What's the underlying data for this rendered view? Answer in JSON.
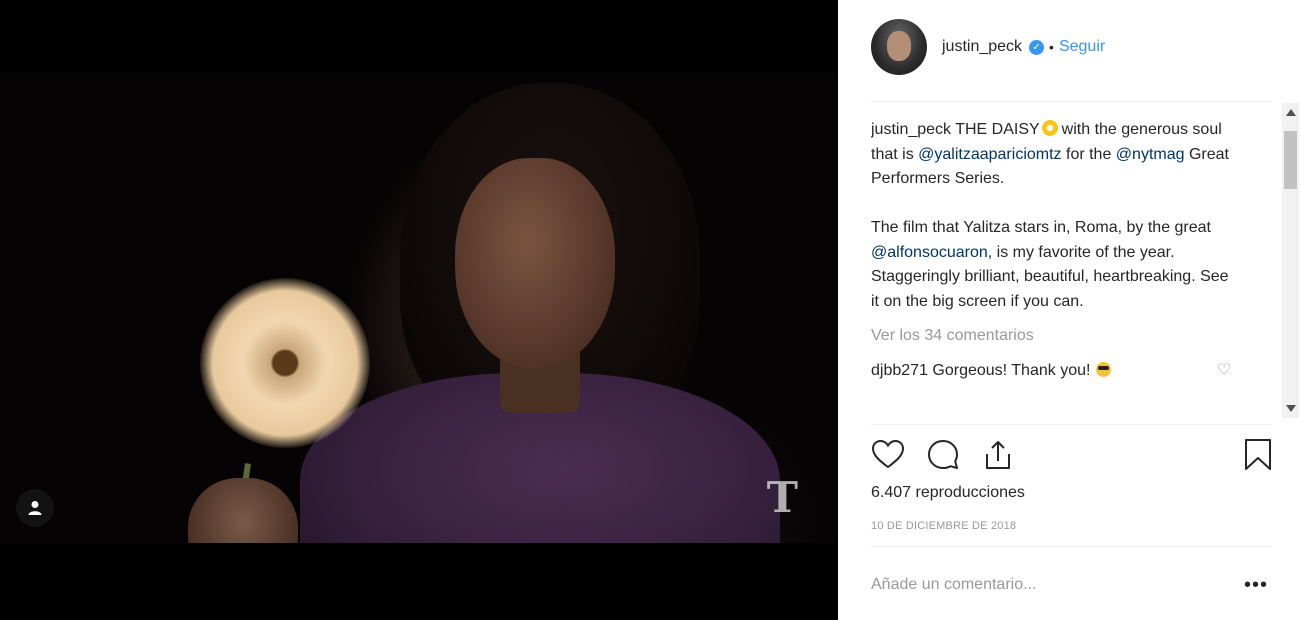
{
  "post": {
    "username": "justin_peck",
    "follow_label": "Seguir",
    "separator": "•",
    "caption_user": "justin_peck",
    "caption_1": "THE DAISY",
    "caption_2": "with the generous soul that is ",
    "mention_1": "@yalitzaapariciomtz",
    "caption_3": " for the ",
    "mention_2": "@nytmag",
    "caption_4": " Great Performers Series.\n\nThe film that Yalitza stars in, Roma, by the great ",
    "mention_3": "@alfonsocuaron",
    "caption_5": ", is my favorite of the year. Staggeringly brilliant, beautiful, heartbreaking. See it on the big screen if you can.",
    "view_comments": "Ver los 34 comentarios",
    "comment_user": "djbb271",
    "comment_text": "Gorgeous! Thank you!",
    "views": "6.407 reproducciones",
    "date": "10 DE DICIEMBRE DE 2018",
    "comment_placeholder": "Añade un comentario...",
    "more_label": "•••"
  },
  "media": {
    "watermark": "T"
  },
  "colors": {
    "accent": "#3897f0",
    "mention": "#003569",
    "muted": "#999999"
  },
  "icons": [
    "verified-badge-icon",
    "daisy-emoji-icon",
    "cool-emoji-icon",
    "heart-icon",
    "comment-icon",
    "share-icon",
    "bookmark-icon",
    "user-tag-icon",
    "nyt-logo-icon"
  ]
}
